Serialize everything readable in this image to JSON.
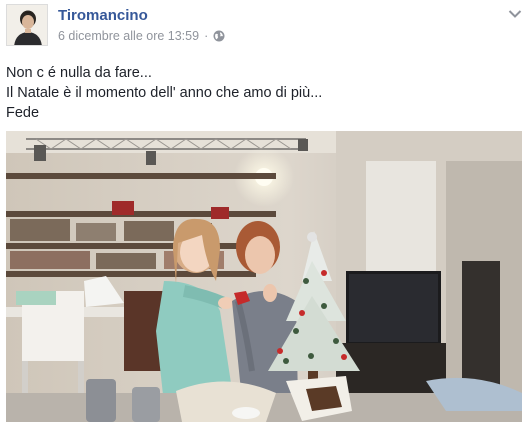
{
  "post": {
    "author_name": "Tiromancino",
    "timestamp": "6 dicembre alle ore 13:59",
    "separator": "·",
    "audience_icon": "globe-icon",
    "menu_icon": "chevron-down-icon",
    "text_lines": [
      "Non c é nulla da fare...",
      "Il Natale è il momento dell' anno che amo di più...",
      "Fede"
    ]
  },
  "colors": {
    "author_link": "#365899",
    "meta_text": "#90949c",
    "body_text": "#1d2129"
  }
}
